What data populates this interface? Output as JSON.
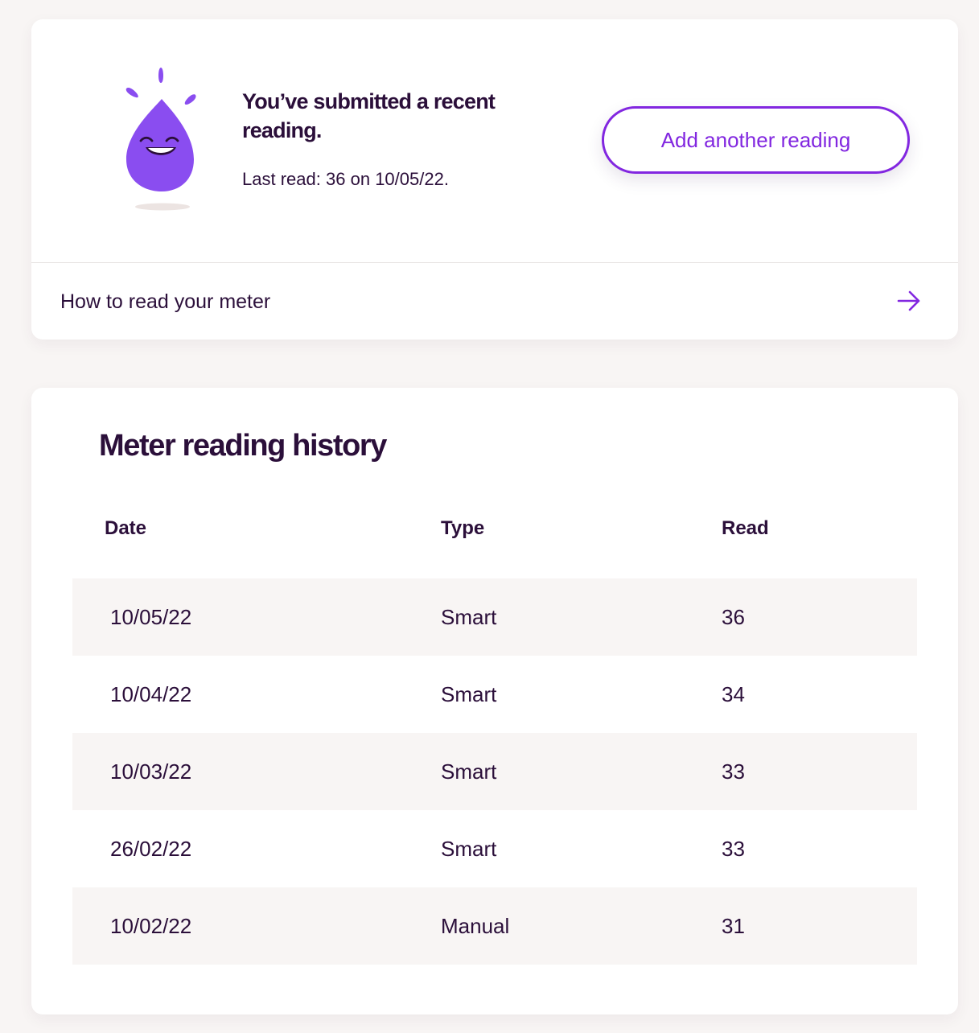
{
  "status": {
    "title": "You’ve submitted a recent reading.",
    "last_read_label": "Last read:",
    "last_read_value": "36",
    "last_read_on": "on",
    "last_read_date": "10/05/22.",
    "add_button_label": "Add another reading",
    "mascot_icon": "smiling-water-drop-icon",
    "accent_color": "#8227e0",
    "mascot_color": "#8a4df0"
  },
  "help_link": {
    "label": "How to read your meter",
    "icon": "arrow-right-icon"
  },
  "history": {
    "title": "Meter reading history",
    "columns": {
      "date": "Date",
      "type": "Type",
      "read": "Read"
    },
    "rows": [
      {
        "date": "10/05/22",
        "type": "Smart",
        "read": "36"
      },
      {
        "date": "10/04/22",
        "type": "Smart",
        "read": "34"
      },
      {
        "date": "10/03/22",
        "type": "Smart",
        "read": "33"
      },
      {
        "date": "26/02/22",
        "type": "Smart",
        "read": "33"
      },
      {
        "date": "10/02/22",
        "type": "Manual",
        "read": "31"
      }
    ]
  }
}
